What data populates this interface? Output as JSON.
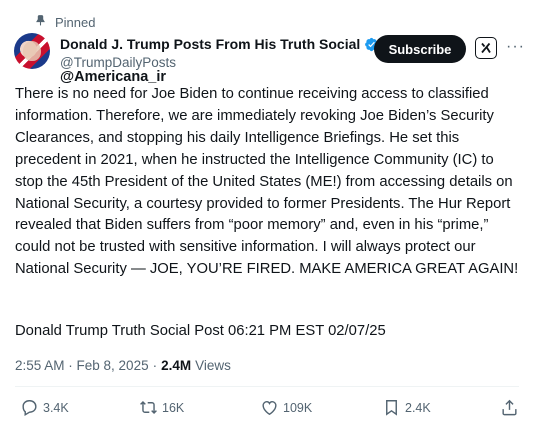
{
  "pinned": {
    "label": "Pinned"
  },
  "author": {
    "name": "Donald J. Trump Posts From His Truth Social",
    "handle": "@TrumpDailyPosts",
    "verified": true,
    "verified_color": "#1d9bf0"
  },
  "watermark": "@Americana_ir",
  "header_actions": {
    "subscribe_label": "Subscribe",
    "grok_icon": "grok-icon",
    "more_icon": "more-icon"
  },
  "tweet": {
    "body": "There is no need for Joe Biden to continue receiving access to classified information. Therefore, we are immediately revoking Joe Biden’s Security Clearances, and stopping his daily Intelligence Briefings. He set this precedent in 2021, when he instructed the Intelligence Community (IC) to stop the 45th President of the United States (ME!) from accessing details on National Security, a courtesy provided to former Presidents. The Hur Report revealed that Biden suffers from “poor memory” and, even in his “prime,” could not be trusted with sensitive information. I will always protect our National Security — JOE, YOU’RE FIRED. MAKE AMERICA GREAT AGAIN!",
    "footer": "Donald Trump Truth Social Post 06:21 PM EST 02/07/25"
  },
  "meta": {
    "timestamp": "2:55 AM · Feb 8, 2025",
    "separator": "·",
    "views_count": "2.4M",
    "views_label": "Views"
  },
  "actions": {
    "replies": "3.4K",
    "reposts": "16K",
    "likes": "109K",
    "bookmarks": "2.4K"
  },
  "colors": {
    "text": "#0f1419",
    "secondary": "#536471",
    "accent": "#1d9bf0",
    "divider": "#eff3f4"
  }
}
